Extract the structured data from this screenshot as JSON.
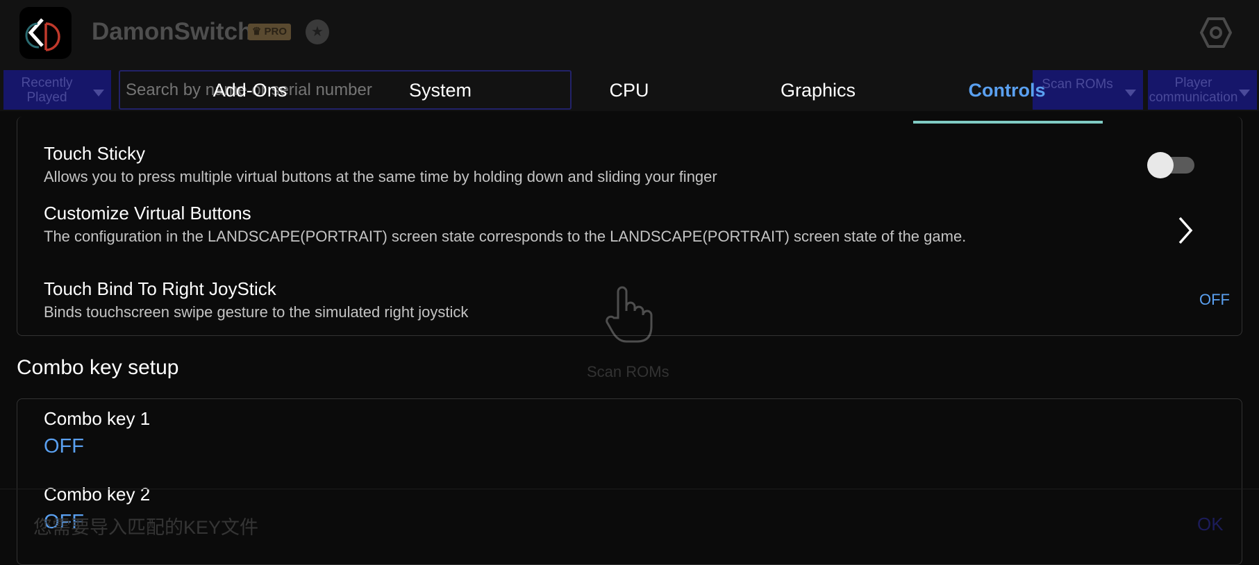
{
  "header": {
    "app_title": "DamonSwitch",
    "pro_badge": "PRO",
    "icons": [
      "damonswitch-logo",
      "crown-icon",
      "medal-icon",
      "settings-gear-icon"
    ]
  },
  "toolbar": {
    "recently_played": "Recently Played",
    "search_placeholder": "Search by name or serial number",
    "scan_roms": "Scan ROMs",
    "player_communication": "Player communication"
  },
  "tabs": [
    {
      "label": "Add-Ons"
    },
    {
      "label": "System"
    },
    {
      "label": "CPU"
    },
    {
      "label": "Graphics"
    },
    {
      "label": "Controls",
      "active": true
    }
  ],
  "settings": {
    "touch_sticky": {
      "title": "Touch Sticky",
      "desc": "Allows you to press multiple virtual buttons at the same time by holding down and sliding your finger",
      "enabled": false
    },
    "customize": {
      "title": "Customize Virtual Buttons",
      "desc": "The configuration in the LANDSCAPE(PORTRAIT) screen state corresponds to the LANDSCAPE(PORTRAIT) screen state of the game."
    },
    "touch_bind": {
      "title": "Touch Bind To Right JoyStick",
      "desc": "Binds touchscreen swipe gesture to the simulated right joystick",
      "value": "OFF"
    }
  },
  "empty_state": {
    "label": "Scan ROMs",
    "icon": "hand-pointer-icon"
  },
  "combo": {
    "section_title": "Combo key setup",
    "items": [
      {
        "title": "Combo key 1",
        "value": "OFF"
      },
      {
        "title": "Combo key 2",
        "value": "OFF"
      }
    ]
  },
  "dialog": {
    "message": "您需要导入匹配的KEY文件",
    "ok": "OK"
  },
  "colors": {
    "accent": "#5aa0f0",
    "indicator": "#80cbc4",
    "dropdown_bg": "#16166a"
  }
}
